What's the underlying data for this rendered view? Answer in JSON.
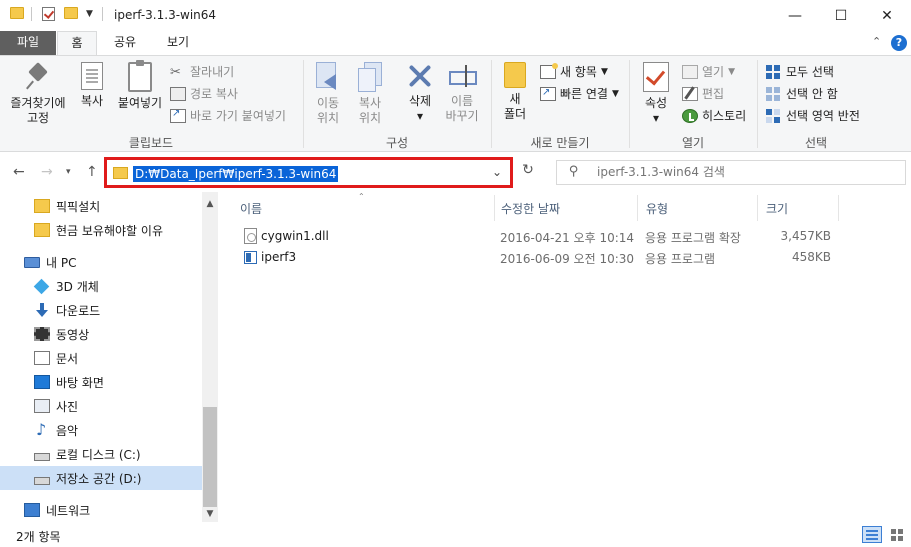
{
  "window": {
    "title": "iperf-3.1.3-win64",
    "minimize": "—",
    "maximize": "☐",
    "close": "✕"
  },
  "ribbon_tabs": [
    "파일",
    "홈",
    "공유",
    "보기"
  ],
  "ribbon": {
    "clipboard": {
      "label": "클립보드",
      "pin": "즐겨찾기에\n고정",
      "pin_line1": "즐겨찾기에",
      "pin_line2": "고정",
      "copy": "복사",
      "paste": "붙여넣기",
      "cut": "잘라내기",
      "copy_path": "경로 복사",
      "paste_shortcut": "바로 가기 붙여넣기"
    },
    "organize": {
      "label": "구성",
      "move_line1": "이동",
      "move_line2": "위치",
      "copy_line1": "복사",
      "copy_line2": "위치",
      "delete": "삭제",
      "rename_line1": "이름",
      "rename_line2": "바꾸기"
    },
    "new": {
      "label": "새로 만들기",
      "folder_line1": "새",
      "folder_line2": "폴더",
      "new_item": "새 항목",
      "easy_access": "빠른 연결"
    },
    "open": {
      "label": "열기",
      "properties": "속성",
      "open": "열기",
      "edit": "편집",
      "history": "히스토리"
    },
    "select": {
      "label": "선택",
      "select_all": "모두 선택",
      "select_none": "선택 안 함",
      "invert": "선택 영역 반전"
    }
  },
  "address": {
    "path": "D:₩Data_Iperf₩iperf-3.1.3-win64",
    "highlight_color": "#e01b1b"
  },
  "search": {
    "placeholder": "iperf-3.1.3-win64 검색"
  },
  "nav_pane": [
    {
      "label": "픽픽설치",
      "icon": "folder-icon"
    },
    {
      "label": "현금 보유해야할 이유",
      "icon": "folder-icon"
    },
    {
      "label": "내 PC",
      "icon": "pc-icon"
    },
    {
      "label": "3D 개체",
      "icon": "3d-objects-icon"
    },
    {
      "label": "다운로드",
      "icon": "download-icon"
    },
    {
      "label": "동영상",
      "icon": "video-icon"
    },
    {
      "label": "문서",
      "icon": "document-icon"
    },
    {
      "label": "바탕 화면",
      "icon": "desktop-icon"
    },
    {
      "label": "사진",
      "icon": "pictures-icon"
    },
    {
      "label": "음악",
      "icon": "music-icon"
    },
    {
      "label": "로컬 디스크 (C:)",
      "icon": "drive-icon"
    },
    {
      "label": "저장소 공간 (D:)",
      "icon": "drive-icon",
      "selected": true
    },
    {
      "label": "네트워크",
      "icon": "network-icon"
    }
  ],
  "columns": {
    "name": "이름",
    "date": "수정한 날짜",
    "type": "유형",
    "size": "크기"
  },
  "files": [
    {
      "name": "cygwin1.dll",
      "date": "2016-04-21 오후 10:14",
      "type": "응용 프로그램 확장",
      "size": "3,457KB",
      "icon": "dll-file-icon"
    },
    {
      "name": "iperf3",
      "date": "2016-06-09 오전 10:30",
      "type": "응용 프로그램",
      "size": "458KB",
      "icon": "exe-file-icon"
    }
  ],
  "status": {
    "item_count": "2개 항목"
  },
  "colors": {
    "accent": "#0a64d8",
    "file_tab": "#5f5f5f",
    "selection": "#cce0f7",
    "folder": "#f5c94c"
  }
}
